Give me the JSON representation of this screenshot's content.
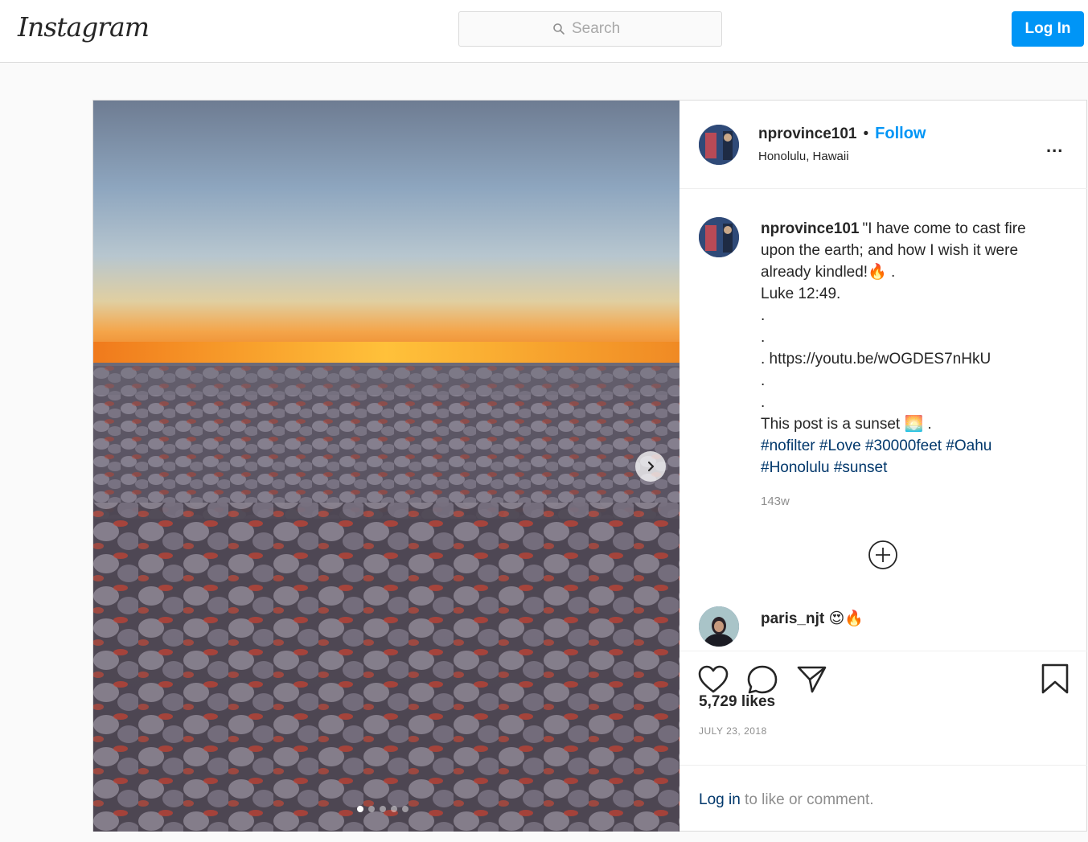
{
  "header": {
    "logo_text": "Instagram",
    "search_placeholder": "Search",
    "login_label": "Log In",
    "accent_color": "#0095f6"
  },
  "post": {
    "username": "nprovince101",
    "separator": "•",
    "follow_label": "Follow",
    "location": "Honolulu, Hawaii",
    "more_label": "...",
    "caption": {
      "lines": [
        "\"I have come to cast fire upon the earth; and how I wish it were already kindled!🔥 .",
        "Luke 12:49.",
        ".",
        ".",
        ". https://youtu.be/wOGDES7nHkU",
        ".",
        ".",
        "This post is a sunset 🌅 ."
      ],
      "hashtags": [
        "#nofilter",
        "#Love",
        "#30000feet",
        "#Oahu",
        "#Honolulu",
        "#sunset"
      ]
    },
    "age": "143w",
    "comment": {
      "username": "paris_njt",
      "text": "😍🔥"
    },
    "likes": "5,729 likes",
    "date": "JULY 23, 2018",
    "footer": {
      "login_link": "Log in",
      "rest": " to like or comment."
    },
    "carousel": {
      "slides": 5,
      "active": 1
    },
    "icons": [
      "heart-icon",
      "comment-icon",
      "share-icon",
      "bookmark-icon",
      "search-icon",
      "chevron-right-icon",
      "plus-circle-icon",
      "more-icon"
    ]
  }
}
